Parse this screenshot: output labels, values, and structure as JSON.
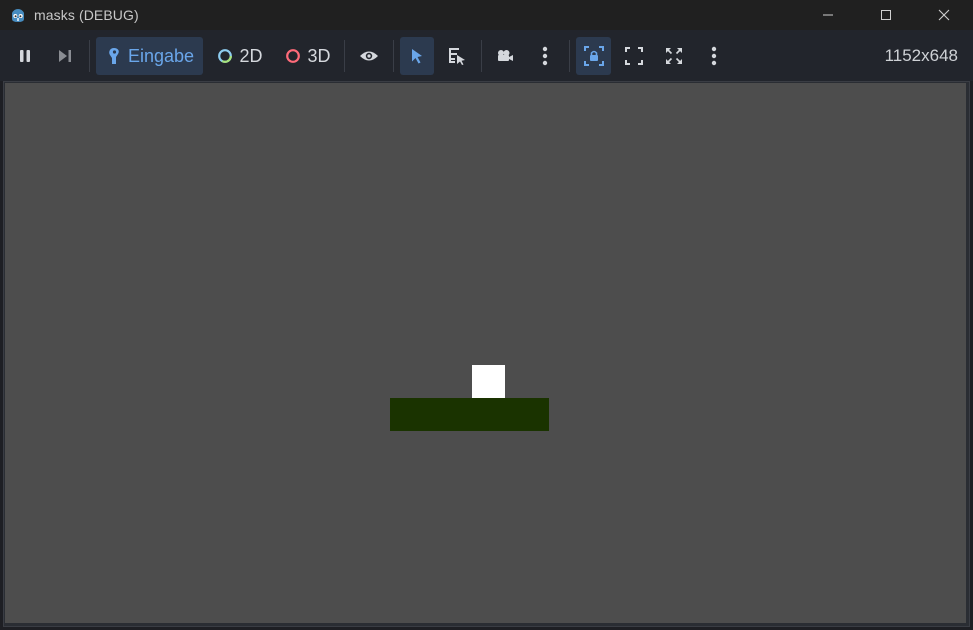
{
  "window": {
    "title": "masks (DEBUG)",
    "icon": "godot-icon",
    "controls": [
      "minimize-icon",
      "maximize-icon",
      "close-icon"
    ]
  },
  "toolbar": {
    "pause_icon": "pause-icon",
    "next_frame_icon": "next-frame-icon",
    "input_label": "Eingabe",
    "mode_2d_label": "2D",
    "mode_3d_label": "3D",
    "visibility_icon": "eye-icon",
    "select_icon": "select-arrow-icon",
    "list_select_icon": "list-select-icon",
    "camera_icon": "camera-icon",
    "more_icon": "more-vertical-icon",
    "lock_icon": "lock-frame-icon",
    "fullscreen_icon": "fullscreen-icon",
    "expand_icon": "expand-icon",
    "resolution": "1152x648"
  },
  "colors": {
    "accent": "#6aa6ea",
    "mode_2d": "#8ecdf0",
    "mode_3d": "#ff6b7a",
    "viewport_bg": "#4d4d4d",
    "ground": "#1a3300",
    "box": "#ffffff"
  }
}
